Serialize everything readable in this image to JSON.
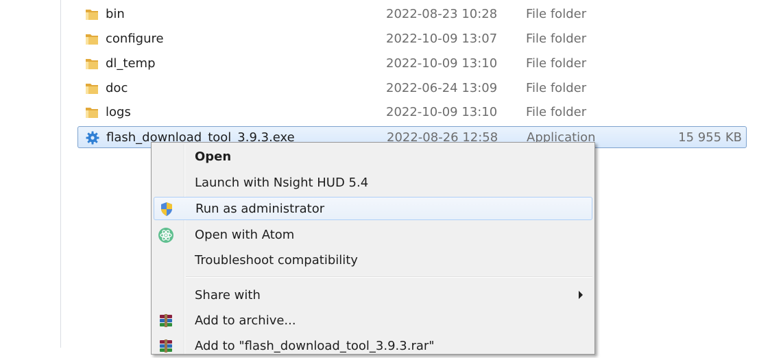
{
  "files": [
    {
      "name": "bin",
      "date": "2022-08-23 10:28",
      "type": "File folder",
      "size": "",
      "icon": "folder-icon"
    },
    {
      "name": "configure",
      "date": "2022-10-09 13:07",
      "type": "File folder",
      "size": "",
      "icon": "folder-icon"
    },
    {
      "name": "dl_temp",
      "date": "2022-10-09 13:10",
      "type": "File folder",
      "size": "",
      "icon": "folder-icon"
    },
    {
      "name": "doc",
      "date": "2022-06-24 13:09",
      "type": "File folder",
      "size": "",
      "icon": "folder-icon"
    },
    {
      "name": "logs",
      "date": "2022-10-09 13:10",
      "type": "File folder",
      "size": "",
      "icon": "folder-icon"
    },
    {
      "name": "flash_download_tool_3.9.3.exe",
      "date": "2022-08-26 12:58",
      "type": "Application",
      "size": "15 955 KB",
      "icon": "app-gear-icon"
    }
  ],
  "context_menu": {
    "items": [
      {
        "label": "Open",
        "bold": true,
        "icon": ""
      },
      {
        "label": "Launch with Nsight HUD 5.4",
        "icon": ""
      },
      {
        "label": "Run as administrator",
        "icon": "uac-shield-icon",
        "highlighted": true
      },
      {
        "label": "Open with Atom",
        "icon": "atom-icon"
      },
      {
        "label": "Troubleshoot compatibility",
        "icon": ""
      },
      {
        "label": "Share with",
        "icon": "",
        "submenu": true
      },
      {
        "label": "Add to archive...",
        "icon": "winrar-icon"
      },
      {
        "label": "Add to \"flash_download_tool_3.9.3.rar\"",
        "icon": "winrar-icon"
      }
    ]
  },
  "colors": {
    "selection": "#d6e7fb",
    "selection_border": "#7da2ce",
    "menu_background": "#f0f0f0",
    "menu_hover_border": "#aecff7",
    "folder": "#e8b64c"
  }
}
